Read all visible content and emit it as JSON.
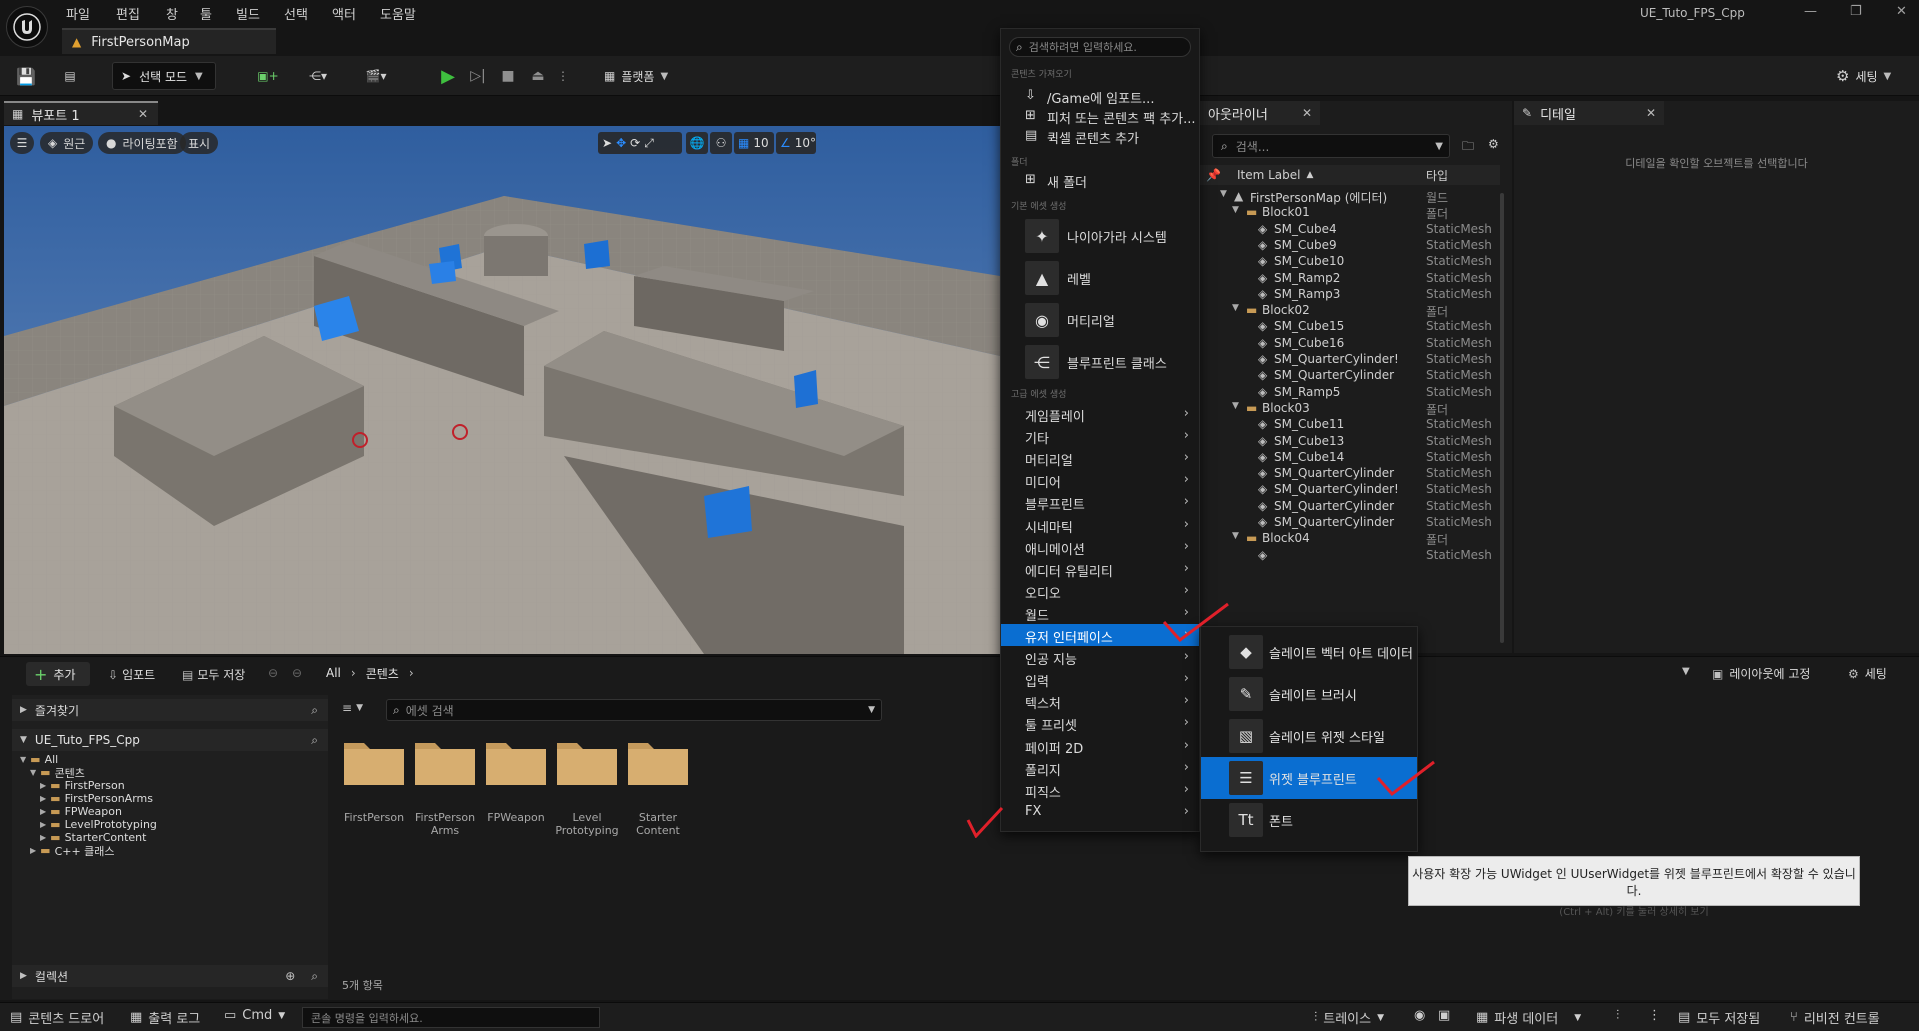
{
  "app": {
    "project_name": "UE_Tuto_FPS_Cpp",
    "document_tab": "FirstPersonMap"
  },
  "menubar": [
    "파일",
    "편집",
    "창",
    "툴",
    "빌드",
    "선택",
    "액터",
    "도움말"
  ],
  "toolbar": {
    "select_mode": "선택 모드",
    "platforms": "플랫폼",
    "settings": "세팅"
  },
  "viewport": {
    "tab_label": "뷰포트 1",
    "perspective": "원근",
    "lighting": "라이팅포함",
    "show": "표시",
    "grid_snap": "10",
    "rotation_snap": "10°"
  },
  "outliner": {
    "tab_label": "아웃라이너",
    "search_placeholder": "검색...",
    "col_label": "Item Label",
    "col_type": "타입",
    "rows": [
      {
        "name": "FirstPersonMap (에디터)",
        "type": "월드",
        "indent": 0,
        "kind": "world",
        "expanded": true
      },
      {
        "name": "Block01",
        "type": "폴더",
        "indent": 1,
        "kind": "folder",
        "expanded": true
      },
      {
        "name": "SM_Cube4",
        "type": "StaticMesh",
        "indent": 2,
        "kind": "mesh"
      },
      {
        "name": "SM_Cube9",
        "type": "StaticMesh",
        "indent": 2,
        "kind": "mesh"
      },
      {
        "name": "SM_Cube10",
        "type": "StaticMesh",
        "indent": 2,
        "kind": "mesh"
      },
      {
        "name": "SM_Ramp2",
        "type": "StaticMesh",
        "indent": 2,
        "kind": "mesh"
      },
      {
        "name": "SM_Ramp3",
        "type": "StaticMesh",
        "indent": 2,
        "kind": "mesh"
      },
      {
        "name": "Block02",
        "type": "폴더",
        "indent": 1,
        "kind": "folder",
        "expanded": true
      },
      {
        "name": "SM_Cube15",
        "type": "StaticMesh",
        "indent": 2,
        "kind": "mesh"
      },
      {
        "name": "SM_Cube16",
        "type": "StaticMesh",
        "indent": 2,
        "kind": "mesh"
      },
      {
        "name": "SM_QuarterCylinder!",
        "type": "StaticMesh",
        "indent": 2,
        "kind": "mesh"
      },
      {
        "name": "SM_QuarterCylinder",
        "type": "StaticMesh",
        "indent": 2,
        "kind": "mesh"
      },
      {
        "name": "SM_Ramp5",
        "type": "StaticMesh",
        "indent": 2,
        "kind": "mesh"
      },
      {
        "name": "Block03",
        "type": "폴더",
        "indent": 1,
        "kind": "folder",
        "expanded": true
      },
      {
        "name": "SM_Cube11",
        "type": "StaticMesh",
        "indent": 2,
        "kind": "mesh"
      },
      {
        "name": "SM_Cube13",
        "type": "StaticMesh",
        "indent": 2,
        "kind": "mesh"
      },
      {
        "name": "SM_Cube14",
        "type": "StaticMesh",
        "indent": 2,
        "kind": "mesh"
      },
      {
        "name": "SM_QuarterCylinder",
        "type": "StaticMesh",
        "indent": 2,
        "kind": "mesh"
      },
      {
        "name": "SM_QuarterCylinder!",
        "type": "StaticMesh",
        "indent": 2,
        "kind": "mesh"
      },
      {
        "name": "SM_QuarterCylinder",
        "type": "StaticMesh",
        "indent": 2,
        "kind": "mesh"
      },
      {
        "name": "SM_QuarterCylinder",
        "type": "StaticMesh",
        "indent": 2,
        "kind": "mesh"
      },
      {
        "name": "Block04",
        "type": "폴더",
        "indent": 1,
        "kind": "folder",
        "expanded": true
      },
      {
        "name": "",
        "type": "StaticMesh",
        "indent": 2,
        "kind": "mesh"
      }
    ]
  },
  "details": {
    "tab_label": "디테일",
    "empty_message": "디테일을 확인할 오브젝트를 선택합니다"
  },
  "content_browser": {
    "add": "추가",
    "import": "임포트",
    "save_all": "모두 저장",
    "path": [
      "All",
      "콘텐츠"
    ],
    "lock_layout": "레이아웃에 고정",
    "settings": "세팅",
    "favorites": "즐겨찾기",
    "project": "UE_Tuto_FPS_Cpp",
    "tree": [
      {
        "label": "All",
        "indent": 0,
        "expanded": true
      },
      {
        "label": "콘텐츠",
        "indent": 1,
        "expanded": true
      },
      {
        "label": "FirstPerson",
        "indent": 2
      },
      {
        "label": "FirstPersonArms",
        "indent": 2
      },
      {
        "label": "FPWeapon",
        "indent": 2
      },
      {
        "label": "LevelPrototyping",
        "indent": 2
      },
      {
        "label": "StarterContent",
        "indent": 2
      },
      {
        "label": "C++ 클래스",
        "indent": 1
      }
    ],
    "collections": "컬렉션",
    "search_placeholder": "에셋 검색",
    "folders": [
      {
        "line1": "FirstPerson",
        "line2": ""
      },
      {
        "line1": "FirstPerson",
        "line2": "Arms"
      },
      {
        "line1": "FPWeapon",
        "line2": ""
      },
      {
        "line1": "Level",
        "line2": "Prototyping"
      },
      {
        "line1": "Starter",
        "line2": "Content"
      }
    ],
    "item_count": "5개 항목"
  },
  "statusbar": {
    "content_drawer": "콘텐츠 드로어",
    "output_log": "출력 로그",
    "cmd": "Cmd",
    "cmd_placeholder": "콘솔 명령을 입력하세요.",
    "trace": "트레이스",
    "derived_data": "파생 데이터",
    "save_all": "모두 저장됨",
    "revision": "리비전 컨트롤"
  },
  "context_menu": {
    "search_placeholder": "검색하려면 입력하세요.",
    "section_get": "콘텐츠 가져오기",
    "import_game": "/Game에 임포트...",
    "add_feature": "피처 또는 콘텐츠 팩 추가...",
    "add_quixel": "퀵셀 콘텐츠 추가",
    "section_folder": "폴더",
    "new_folder": "새 폴더",
    "section_basic": "기본 에셋 생성",
    "basic_items": [
      "나이아가라 시스템",
      "레벨",
      "머티리얼",
      "블루프린트 클래스"
    ],
    "section_advanced": "고급 에셋 생성",
    "advanced_items": [
      "게임플레이",
      "기타",
      "머티리얼",
      "미디어",
      "블루프린트",
      "시네마틱",
      "애니메이션",
      "에디터 유틸리티",
      "오디오",
      "월드",
      "유저 인터페이스",
      "인공 지능",
      "입력",
      "텍스처",
      "툴 프리셋",
      "페이퍼 2D",
      "폴리지",
      "피직스",
      "FX"
    ],
    "highlighted_index": 10
  },
  "submenu": {
    "items": [
      "슬레이트 벡터 아트 데이터",
      "슬레이트 브러시",
      "슬레이트 위젯 스타일",
      "위젯 블루프린트",
      "폰트"
    ],
    "highlighted_index": 3
  },
  "tooltip": {
    "line1": "사용자 확장 가능 UWidget 인 UUserWidget를 위젯 블루프린트에서 확장할 수 있습니다.",
    "line2": "(Ctrl + Alt) 키를 눌러 상세히 보기"
  },
  "colors": {
    "accent": "#0a6ed1",
    "annotation": "#e0202a",
    "play_green": "#3fbf3f"
  }
}
